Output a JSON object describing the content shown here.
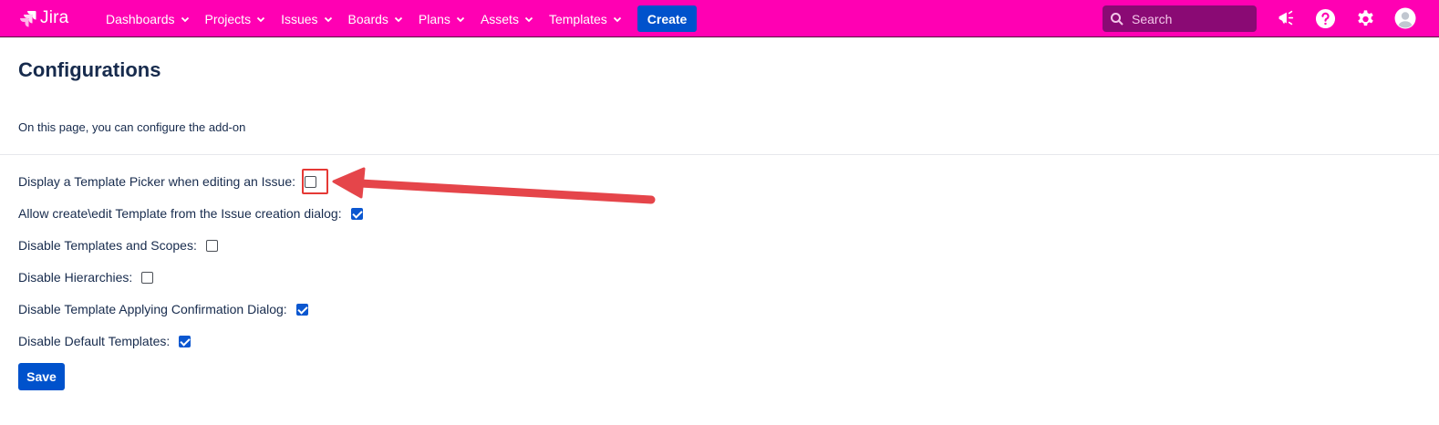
{
  "header": {
    "logo_text": "Jira",
    "nav_items": [
      {
        "label": "Dashboards"
      },
      {
        "label": "Projects"
      },
      {
        "label": "Issues"
      },
      {
        "label": "Boards"
      },
      {
        "label": "Plans"
      },
      {
        "label": "Assets"
      },
      {
        "label": "Templates"
      }
    ],
    "create_label": "Create",
    "search_placeholder": "Search",
    "icons": [
      "notifications-megaphone-icon",
      "help-icon",
      "settings-gear-icon",
      "user-avatar-icon"
    ],
    "bar_color": "#ff00b3"
  },
  "main": {
    "title": "Configurations",
    "description": "On this page, you can configure the add-on",
    "options": [
      {
        "label": "Display a Template Picker when editing an Issue:",
        "checked": false,
        "highlighted": true
      },
      {
        "label": "Allow create\\edit Template from the Issue creation dialog:",
        "checked": true
      },
      {
        "label": "Disable Templates and Scopes:",
        "checked": false
      },
      {
        "label": "Disable Hierarchies:",
        "checked": false
      },
      {
        "label": "Disable Template Applying Confirmation Dialog:",
        "checked": true
      },
      {
        "label": "Disable Default Templates:",
        "checked": true
      }
    ],
    "save_label": "Save"
  },
  "annotation": {
    "color": "#e53935",
    "type": "arrow-pointing-left"
  }
}
